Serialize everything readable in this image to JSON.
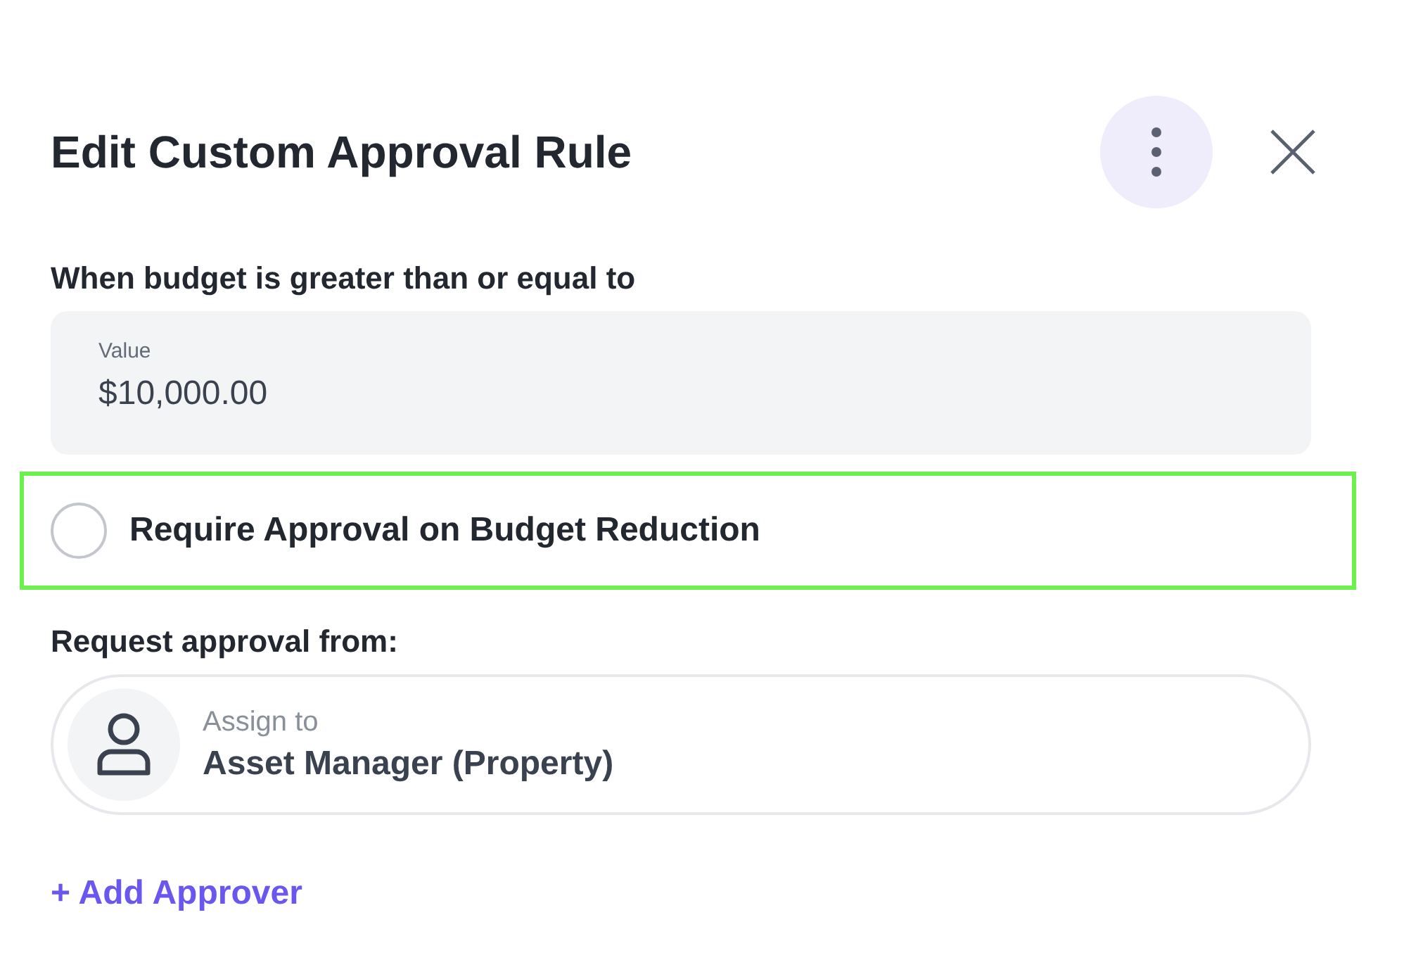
{
  "header": {
    "title": "Edit Custom Approval Rule"
  },
  "budget": {
    "label": "When budget is greater than or equal to",
    "field_label": "Value",
    "value": "$10,000.00"
  },
  "option": {
    "label": "Require Approval on Budget Reduction",
    "checked": false,
    "highlighted": true
  },
  "approvers": {
    "label": "Request approval from:",
    "items": [
      {
        "caption": "Assign to",
        "name": "Asset Manager (Property)"
      }
    ]
  },
  "add_button": "+ Add Approver"
}
